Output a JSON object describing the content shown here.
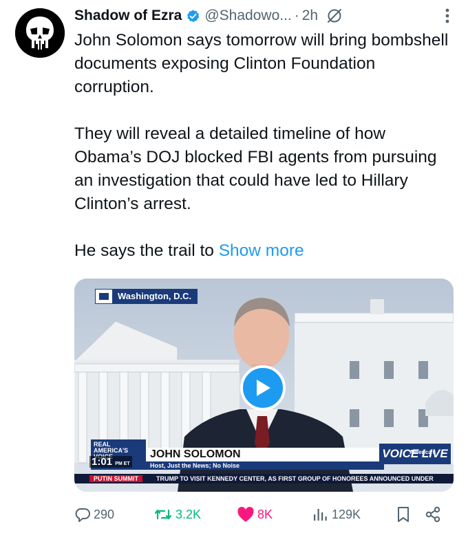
{
  "post": {
    "author_name": "Shadow of Ezra",
    "handle": "@Shadowo...",
    "separator": "·",
    "time": "2h",
    "paragraphs": [
      "John Solomon says tomorrow will bring bombshell documents exposing Clinton Foundation corruption.",
      "They will reveal a detailed timeline of how Obama’s DOJ blocked FBI agents from pursuing an investigation that could have led to Hillary Clinton’s arrest."
    ],
    "truncated_text": "He says the trail to",
    "show_more_label": "Show more"
  },
  "video": {
    "location": "Washington, D.C.",
    "network_badge": "REAL AMERICA'S VOICE",
    "guest_name": "JOHN SOLOMON",
    "guest_title": "Host, Just the News; No Noise",
    "clock": "1:01",
    "clock_suffix": "PM ET",
    "brand_top": "America's",
    "brand": "VOICE LIVE",
    "ticker_label": "PUTIN SUMMIT",
    "ticker_text": "TRUMP TO VISIT KENNEDY CENTER, AS FIRST GROUP OF HONOREES ANNOUNCED UNDER"
  },
  "actions": {
    "replies": "290",
    "reposts": "3.2K",
    "likes": "8K",
    "views": "129K"
  },
  "colors": {
    "accent": "#1d9bf0",
    "repost": "#00ba7c",
    "like": "#f91880",
    "muted": "#536471"
  }
}
